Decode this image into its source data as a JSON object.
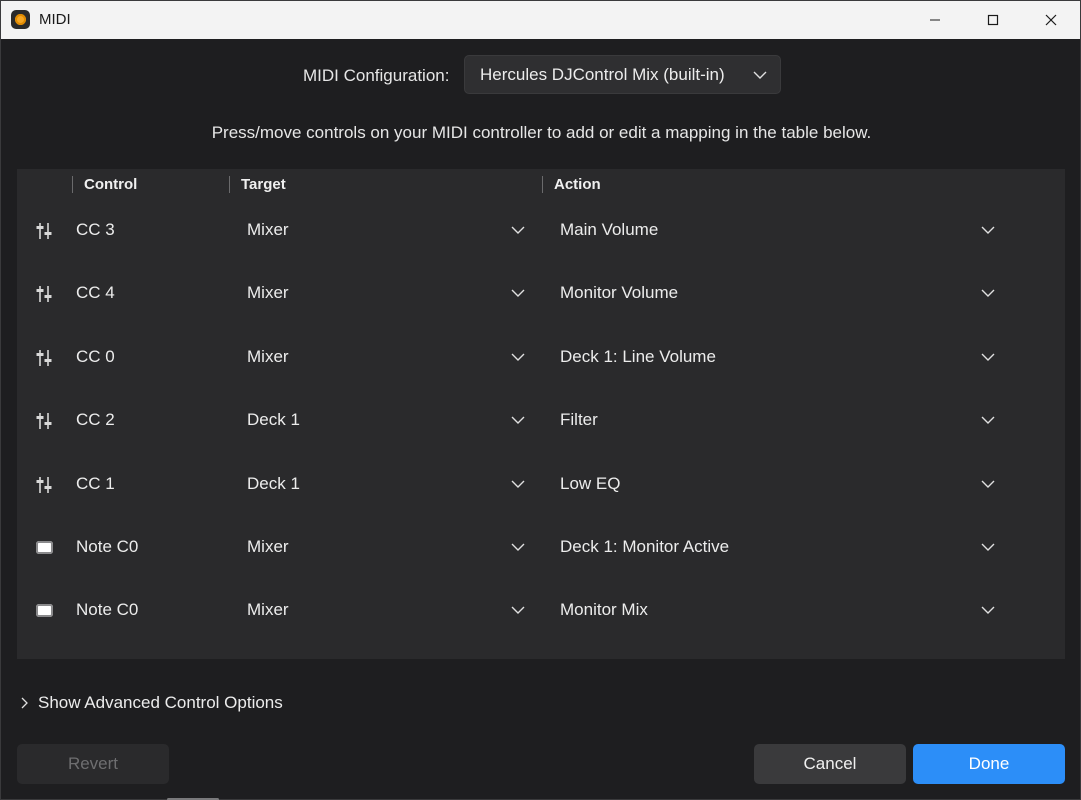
{
  "window": {
    "title": "MIDI"
  },
  "config": {
    "label": "MIDI Configuration:",
    "selected": "Hercules DJControl Mix (built-in)"
  },
  "hint": "Press/move controls on your MIDI controller to add or edit a mapping in the table below.",
  "table": {
    "headers": {
      "control": "Control",
      "target": "Target",
      "action": "Action"
    },
    "rows": [
      {
        "icon": "fader-icon",
        "control": "CC 3",
        "target": "Mixer",
        "action": "Main Volume"
      },
      {
        "icon": "fader-icon",
        "control": "CC 4",
        "target": "Mixer",
        "action": "Monitor Volume"
      },
      {
        "icon": "fader-icon",
        "control": "CC 0",
        "target": "Mixer",
        "action": "Deck 1: Line Volume"
      },
      {
        "icon": "fader-icon",
        "control": "CC 2",
        "target": "Deck 1",
        "action": "Filter"
      },
      {
        "icon": "fader-icon",
        "control": "CC 1",
        "target": "Deck 1",
        "action": "Low EQ"
      },
      {
        "icon": "key-icon",
        "control": "Note C0",
        "target": "Mixer",
        "action": "Deck 1: Monitor Active"
      },
      {
        "icon": "key-icon",
        "control": "Note C0",
        "target": "Mixer",
        "action": "Monitor Mix"
      }
    ]
  },
  "advanced_label": "Show Advanced Control Options",
  "buttons": {
    "revert": "Revert",
    "cancel": "Cancel",
    "done": "Done"
  },
  "colors": {
    "accent": "#2c8ef8",
    "background": "#1e1e20",
    "table_bg": "#2a2a2c"
  }
}
